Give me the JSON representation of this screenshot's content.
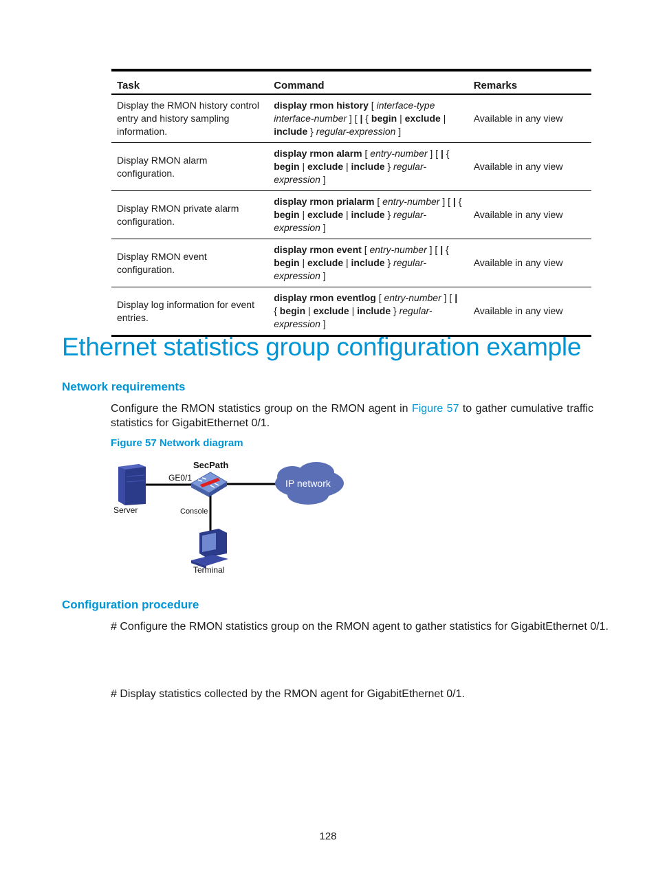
{
  "table": {
    "headers": [
      "Task",
      "Command",
      "Remarks"
    ],
    "rows": [
      {
        "task": "Display the RMON history control entry and history sampling information.",
        "command_parts": [
          {
            "t": "display rmon history",
            "s": "b"
          },
          {
            "t": " [ ",
            "s": "n"
          },
          {
            "t": "interface-type interface-number",
            "s": "i"
          },
          {
            "t": " ] [ ",
            "s": "n"
          },
          {
            "t": "|",
            "s": "b"
          },
          {
            "t": " { ",
            "s": "n"
          },
          {
            "t": "begin",
            "s": "b"
          },
          {
            "t": " | ",
            "s": "n"
          },
          {
            "t": "exclude",
            "s": "b"
          },
          {
            "t": " | ",
            "s": "n"
          },
          {
            "t": "include",
            "s": "b"
          },
          {
            "t": " } ",
            "s": "n"
          },
          {
            "t": "regular-expression",
            "s": "i"
          },
          {
            "t": " ]",
            "s": "n"
          }
        ],
        "remarks": "Available in any view"
      },
      {
        "task": "Display RMON alarm configuration.",
        "command_parts": [
          {
            "t": "display rmon alarm",
            "s": "b"
          },
          {
            "t": " [ ",
            "s": "n"
          },
          {
            "t": "entry-number",
            "s": "i"
          },
          {
            "t": " ] [ ",
            "s": "n"
          },
          {
            "t": "|",
            "s": "b"
          },
          {
            "t": " { ",
            "s": "n"
          },
          {
            "t": "begin",
            "s": "b"
          },
          {
            "t": " | ",
            "s": "n"
          },
          {
            "t": "exclude",
            "s": "b"
          },
          {
            "t": " | ",
            "s": "n"
          },
          {
            "t": "include",
            "s": "b"
          },
          {
            "t": " } ",
            "s": "n"
          },
          {
            "t": "regular-expression",
            "s": "i"
          },
          {
            "t": " ]",
            "s": "n"
          }
        ],
        "remarks": "Available in any view"
      },
      {
        "task": "Display RMON private alarm configuration.",
        "command_parts": [
          {
            "t": "display rmon prialarm",
            "s": "b"
          },
          {
            "t": " [ ",
            "s": "n"
          },
          {
            "t": "entry-number",
            "s": "i"
          },
          {
            "t": " ] [ ",
            "s": "n"
          },
          {
            "t": "|",
            "s": "b"
          },
          {
            "t": " { ",
            "s": "n"
          },
          {
            "t": "begin",
            "s": "b"
          },
          {
            "t": " | ",
            "s": "n"
          },
          {
            "t": "exclude",
            "s": "b"
          },
          {
            "t": " | ",
            "s": "n"
          },
          {
            "t": "include",
            "s": "b"
          },
          {
            "t": " } ",
            "s": "n"
          },
          {
            "t": "regular-expression",
            "s": "i"
          },
          {
            "t": " ]",
            "s": "n"
          }
        ],
        "remarks": "Available in any view"
      },
      {
        "task": "Display RMON event configuration.",
        "command_parts": [
          {
            "t": "display rmon event",
            "s": "b"
          },
          {
            "t": " [ ",
            "s": "n"
          },
          {
            "t": "entry-number",
            "s": "i"
          },
          {
            "t": " ] [ ",
            "s": "n"
          },
          {
            "t": "|",
            "s": "b"
          },
          {
            "t": " { ",
            "s": "n"
          },
          {
            "t": "begin",
            "s": "b"
          },
          {
            "t": " | ",
            "s": "n"
          },
          {
            "t": "exclude",
            "s": "b"
          },
          {
            "t": " | ",
            "s": "n"
          },
          {
            "t": "include",
            "s": "b"
          },
          {
            "t": " } ",
            "s": "n"
          },
          {
            "t": "regular-expression",
            "s": "i"
          },
          {
            "t": " ]",
            "s": "n"
          }
        ],
        "remarks": "Available in any view"
      },
      {
        "task": "Display log information for event entries.",
        "command_parts": [
          {
            "t": "display rmon eventlog",
            "s": "b"
          },
          {
            "t": " [ ",
            "s": "n"
          },
          {
            "t": "entry-number",
            "s": "i"
          },
          {
            "t": " ] [ ",
            "s": "n"
          },
          {
            "t": "|",
            "s": "b"
          },
          {
            "t": " { ",
            "s": "n"
          },
          {
            "t": "begin",
            "s": "b"
          },
          {
            "t": " | ",
            "s": "n"
          },
          {
            "t": "exclude",
            "s": "b"
          },
          {
            "t": " | ",
            "s": "n"
          },
          {
            "t": "include",
            "s": "b"
          },
          {
            "t": " } ",
            "s": "n"
          },
          {
            "t": "regular-expression",
            "s": "i"
          },
          {
            "t": " ]",
            "s": "n"
          }
        ],
        "remarks": "Available in any view"
      }
    ]
  },
  "section": {
    "title": "Ethernet statistics group configuration example",
    "network_requirements": {
      "heading": "Network requirements",
      "text_before_link": "Configure the RMON statistics group on the RMON agent in ",
      "link_text": "Figure 57",
      "text_after_link": " to gather cumulative traffic statistics for GigabitEthernet 0/1."
    },
    "figure": {
      "caption": "Figure 57 Network diagram",
      "labels": {
        "device": "SecPath",
        "port": "GE0/1",
        "server": "Server",
        "console": "Console",
        "terminal": "Terminal",
        "cloud": "IP network"
      },
      "colors": {
        "device_blue": "#5b7bc2",
        "cloud_blue": "#5a6fb5",
        "accent_red": "#e02020"
      }
    },
    "configuration_procedure": {
      "heading": "Configuration procedure",
      "step1": "# Configure the RMON statistics group on the RMON agent to gather statistics for GigabitEthernet 0/1.",
      "step2": "# Display statistics collected by the RMON agent for GigabitEthernet 0/1."
    }
  },
  "page_number": "128",
  "colors": {
    "heading_blue": "#0096d6",
    "text": "#1a1a1a"
  }
}
